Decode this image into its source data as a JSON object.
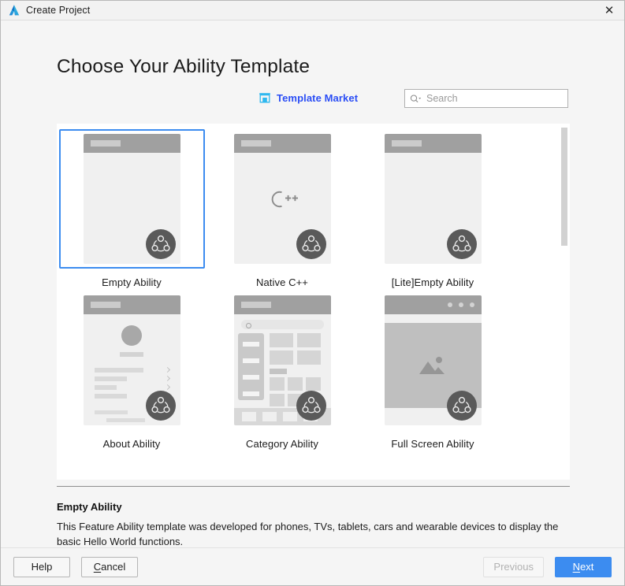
{
  "window": {
    "title": "Create Project",
    "logo_icon": "deveco-logo-icon",
    "close_icon": "close-icon",
    "close_glyph": "✕"
  },
  "page": {
    "heading": "Choose Your Ability Template"
  },
  "toolbar": {
    "template_market_label": "Template Market",
    "template_market_icon": "store-icon",
    "search_icon": "search-dropdown-icon",
    "search_placeholder": "Search",
    "search_value": ""
  },
  "templates": [
    {
      "id": "empty-ability",
      "label": "Empty Ability",
      "selected": true,
      "kind": "blank"
    },
    {
      "id": "native-cpp",
      "label": "Native C++",
      "selected": false,
      "kind": "cpp"
    },
    {
      "id": "lite-empty-ability",
      "label": "[Lite]Empty Ability",
      "selected": false,
      "kind": "blank"
    },
    {
      "id": "about-ability",
      "label": "About Ability",
      "selected": false,
      "kind": "about"
    },
    {
      "id": "category-ability",
      "label": "Category Ability",
      "selected": false,
      "kind": "category"
    },
    {
      "id": "full-screen-ability",
      "label": "Full Screen Ability",
      "selected": false,
      "kind": "fullscreen"
    }
  ],
  "description": {
    "title": "Empty Ability",
    "text": "This Feature Ability template was developed for phones, TVs, tablets, cars and wearable devices to display the basic Hello World functions."
  },
  "footer": {
    "help_label": "Help",
    "cancel_label": "Cancel",
    "cancel_mnemonic": "C",
    "cancel_rest": "ancel",
    "previous_label": "Previous",
    "previous_disabled": true,
    "next_mnemonic": "N",
    "next_rest": "ext",
    "next_label": "Next"
  },
  "colors": {
    "accent_blue": "#3c8cf0",
    "link_blue": "#2b4ef5",
    "badge_gray": "#5a5a5a",
    "thumb_header_gray": "#a0a0a0",
    "thumb_body_gray": "#f0f0f0",
    "window_bg": "#f5f5f5"
  }
}
